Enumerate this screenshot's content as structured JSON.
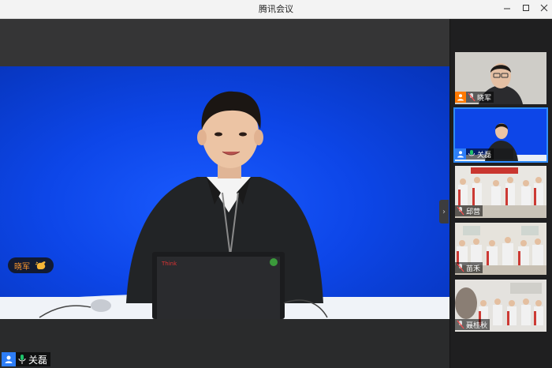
{
  "window": {
    "title": "腾讯会议"
  },
  "main": {
    "reaction": {
      "name": "晓军",
      "emoji": "clap-icon"
    },
    "local_user": {
      "name": "关磊",
      "mic": "mic-on-icon"
    }
  },
  "sidebar": {
    "participants": [
      {
        "name": "晓军",
        "role": "host-icon",
        "mic": "mic-muted-icon",
        "active": false
      },
      {
        "name": "关磊",
        "role": "user-icon",
        "mic": "mic-on-icon",
        "active": true
      },
      {
        "name": "邱营",
        "role": "none",
        "mic": "mic-muted-icon",
        "active": false
      },
      {
        "name": "苗禾",
        "role": "none",
        "mic": "mic-muted-icon",
        "active": false
      },
      {
        "name": "聂桂秋",
        "role": "none",
        "mic": "mic-muted-icon",
        "active": false
      }
    ]
  },
  "colors": {
    "accent": "#2f8cff",
    "host": "#ff7a00",
    "reaction_name": "#ff9a2e",
    "mic_on": "#1fc26b"
  }
}
